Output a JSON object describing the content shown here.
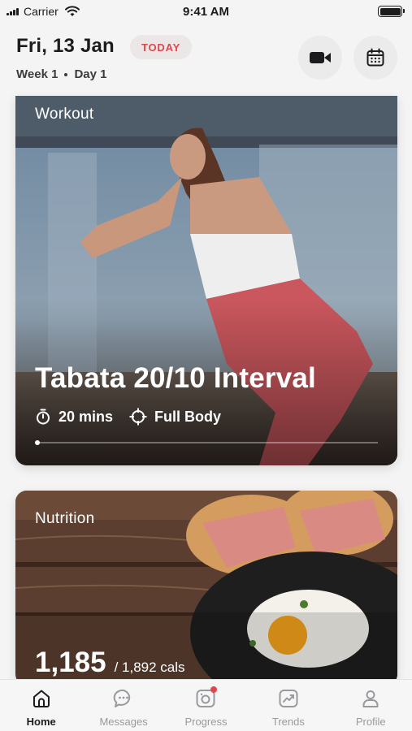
{
  "status_bar": {
    "carrier": "Carrier",
    "time": "9:41 AM",
    "battery_level": 1.0
  },
  "header": {
    "date": "Fri, 13 Jan",
    "today_badge": "TODAY",
    "week": "Week 1",
    "day": "Day 1",
    "video_button_icon": "video-camera-icon",
    "calendar_button_icon": "calendar-icon"
  },
  "workout_card": {
    "label": "Workout",
    "title": "Tabata 20/10 Interval",
    "duration": "20 mins",
    "duration_icon": "stopwatch-icon",
    "focus": "Full Body",
    "focus_icon": "crosshair-icon",
    "carousel_position": 0
  },
  "nutrition_card": {
    "label": "Nutrition",
    "calories_consumed": "1,185",
    "calories_goal": "/ 1,892 cals"
  },
  "tab_bar": {
    "active": "Home",
    "items": [
      {
        "label": "Home",
        "icon": "home-icon",
        "badge": false
      },
      {
        "label": "Messages",
        "icon": "chat-bubble-icon",
        "badge": false
      },
      {
        "label": "Progress",
        "icon": "camera-icon",
        "badge": true
      },
      {
        "label": "Trends",
        "icon": "trend-chart-icon",
        "badge": false
      },
      {
        "label": "Profile",
        "icon": "person-icon",
        "badge": false
      }
    ]
  },
  "colors": {
    "accent": "#e0474c",
    "background": "#f4f4f4",
    "text": "#1c1c1e",
    "inactive": "#9a9a9e"
  }
}
